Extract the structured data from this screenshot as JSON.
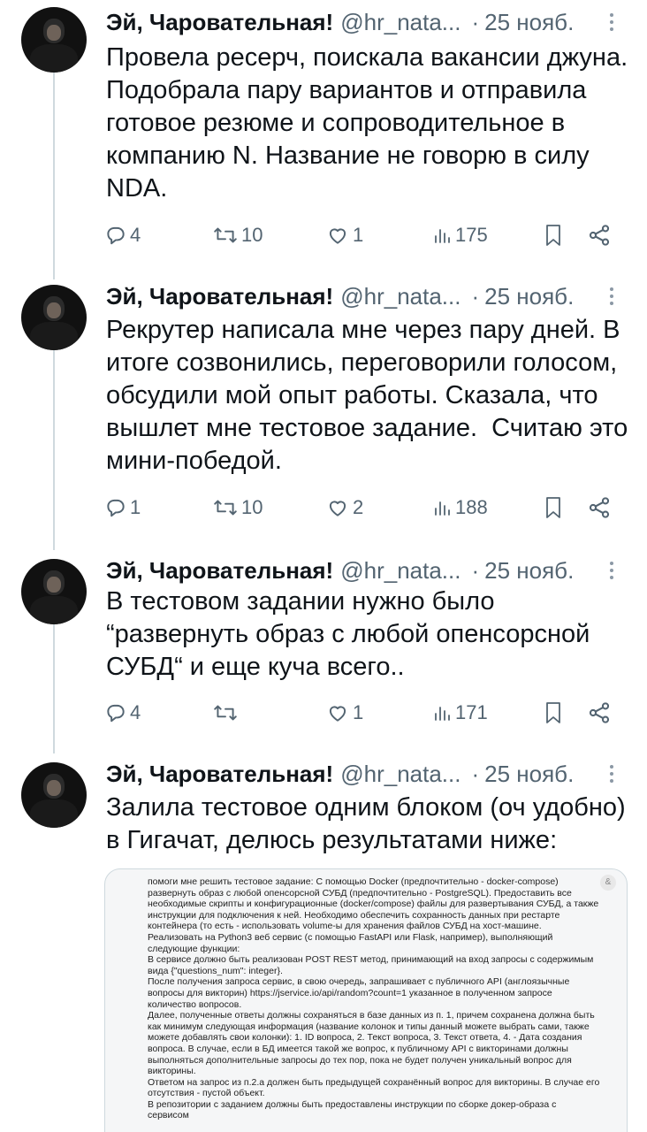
{
  "tweets": [
    {
      "author_name": "Эй, Чаровательная!",
      "handle": "@hr_nata...",
      "separator": "·",
      "date": "25 нояб.",
      "text": "Провела ресерч, поискала вакансии джуна. Подобрала пару вариантов и отправила готовое резюме и сопроводительное в компанию N. Название не говорю в силу NDA.",
      "replies": "4",
      "retweets": "10",
      "likes": "1",
      "views": "175"
    },
    {
      "author_name": "Эй, Чаровательная!",
      "handle": "@hr_nata...",
      "separator": "·",
      "date": "25 нояб.",
      "text": "Рекрутер написала мне через пару дней. В итоге созвонились, переговорили голосом, обсудили мой опыт работы. Сказала, что вышлет мне тестовое задание.  Считаю это мини-победой.",
      "replies": "1",
      "retweets": "10",
      "likes": "2",
      "views": "188"
    },
    {
      "author_name": "Эй, Чаровательная!",
      "handle": "@hr_nata...",
      "separator": "·",
      "date": "25 нояб.",
      "text": "В тестовом задании нужно было “развернуть образ с любой опенсорсной СУБД“ и еще куча всего..",
      "replies": "4",
      "retweets": "",
      "likes": "1",
      "views": "171"
    },
    {
      "author_name": "Эй, Чаровательная!",
      "handle": "@hr_nata...",
      "separator": "·",
      "date": "25 нояб.",
      "text": "Залила тестовое одним блоком (оч удобно) в Гигачат, делюсь результатами ниже:"
    }
  ],
  "attached_image": {
    "icon": "link-icon",
    "lines": [
      "помоги мне решить тестовое задание: С помощью Docker (предпочтительно - docker-compose) развернуть образ с любой опенсорсной СУБД (предпочтительно - PostgreSQL). Предоставить все необходимые скрипты и конфигурационные (docker/compose) файлы для развертывания СУБД, а также инструкции для подключения к ней. Необходимо обеспечить сохранность данных при рестарте контейнера (то есть - использовать volume-ы для хранения файлов СУБД на хост-машине.",
      "Реализовать на Python3 веб сервис (с помощью FastAPI или Flask, например), выполняющий следующие функции:",
      "В сервисе должно быть реализован POST REST метод, принимающий на вход запросы с содержимым вида {\"questions_num\": integer}.",
      "После получения запроса сервис, в свою очередь, запрашивает с публичного API (англоязычные вопросы для викторин) https://jservice.io/api/random?count=1 указанное в полученном запросе количество вопросов.",
      "Далее, полученные ответы должны сохраняться в базе данных из п. 1, причем сохранена должна быть как минимум следующая информация (название колонок и типы данный можете выбрать сами, также можете добавлять свои колонки): 1. ID вопроса, 2. Текст вопроса, 3. Текст ответа, 4. - Дата создания вопроса. В случае, если в БД имеется такой же вопрос, к публичному API с викторинами должны выполняться дополнительные запросы до тех пор, пока не будет получен уникальный вопрос для викторины.",
      "Ответом на запрос из п.2.a должен быть предыдущей сохранённый вопрос для викторины. В случае его отсутствия - пустой объект.",
      "В репозитории с заданием должны быть предоставлены инструкции по сборке докер-образа с сервисом"
    ]
  },
  "colors": {
    "text": "#0f1419",
    "secondary": "#536471",
    "thread_line": "#cfd9de"
  }
}
